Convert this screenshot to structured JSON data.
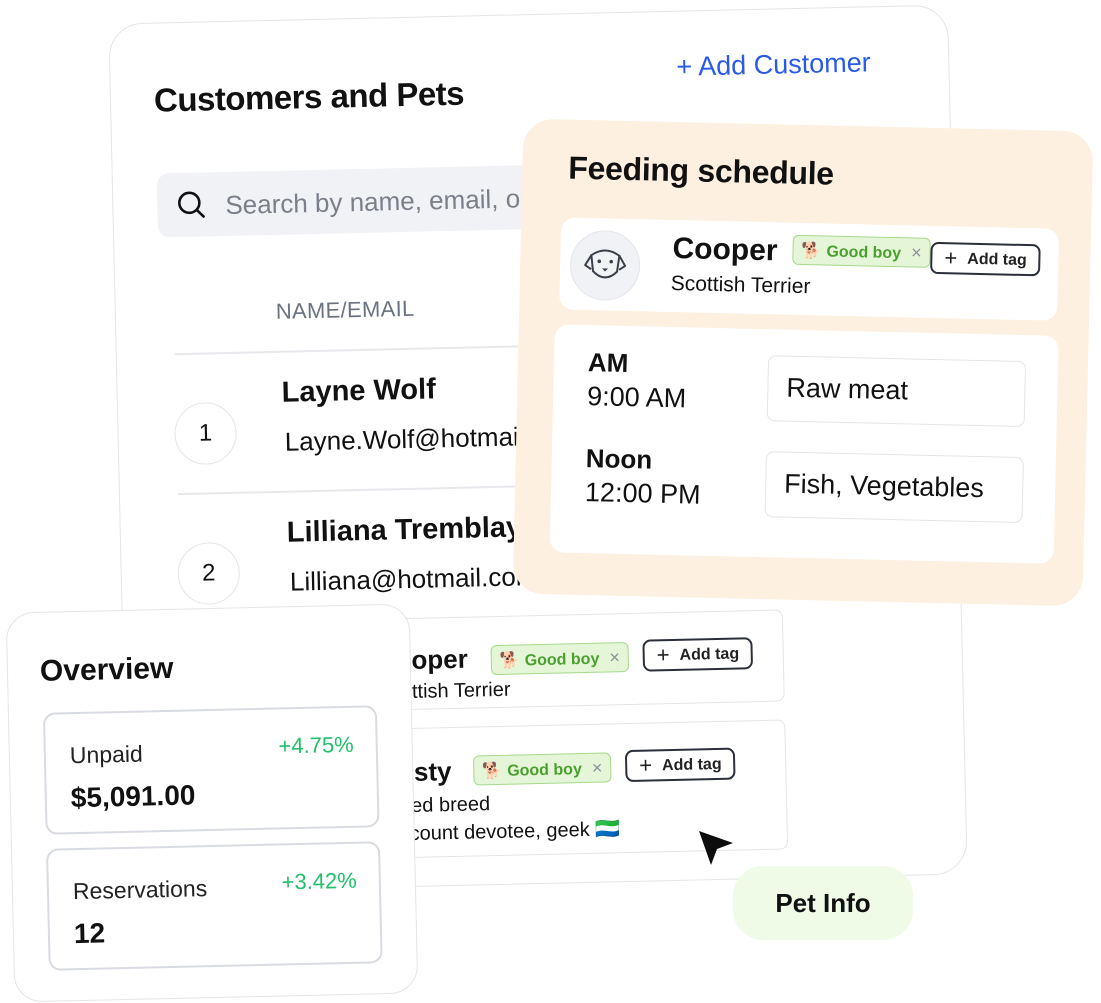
{
  "customers": {
    "title": "Customers and Pets",
    "add_customer_label": "+ Add Customer",
    "search_placeholder": "Search by name, email, or pet",
    "column_header": "NAME/EMAIL",
    "rows": [
      {
        "number": "1",
        "name": "Layne Wolf",
        "email": "Layne.Wolf@hotmail.com"
      },
      {
        "number": "2",
        "name": "Lilliana Tremblay",
        "email": "Lilliana@hotmail.com"
      }
    ],
    "pets": [
      {
        "name": "Cooper",
        "breed": "Scottish Terrier",
        "tag": "Good boy",
        "add_tag": "Add tag"
      },
      {
        "name": "Rusty",
        "breed": "Mixed breed",
        "note": "Discount devotee, geek",
        "tag": "Good boy",
        "add_tag": "Add tag"
      }
    ]
  },
  "feeding": {
    "title": "Feeding schedule",
    "pet": {
      "name": "Cooper",
      "breed": "Scottish Terrier",
      "tag": "Good boy",
      "add_tag": "Add tag"
    },
    "slots": [
      {
        "label": "AM",
        "time": "9:00 AM",
        "food": "Raw meat"
      },
      {
        "label": "Noon",
        "time": "12:00 PM",
        "food": "Fish, Vegetables"
      }
    ]
  },
  "overview": {
    "title": "Overview",
    "stats": [
      {
        "label": "Unpaid",
        "value": "$5,091.00",
        "delta": "+4.75%"
      },
      {
        "label": "Reservations",
        "value": "12",
        "delta": "+3.42%"
      }
    ]
  },
  "pet_info_label": "Pet Info",
  "colors": {
    "accent": "#2a5be6",
    "positive": "#22c06b",
    "tag_bg": "#e4f5d8",
    "tag_text": "#4b9f2f",
    "feeding_bg": "#fef0e0",
    "pill_bg": "#effbe6"
  },
  "icons": {
    "search": "search-icon",
    "dog_avatar": "dog-face-icon",
    "tag_emoji": "🐕",
    "flag_emoji": "🇸🇱",
    "cursor": "cursor-arrow-icon"
  }
}
